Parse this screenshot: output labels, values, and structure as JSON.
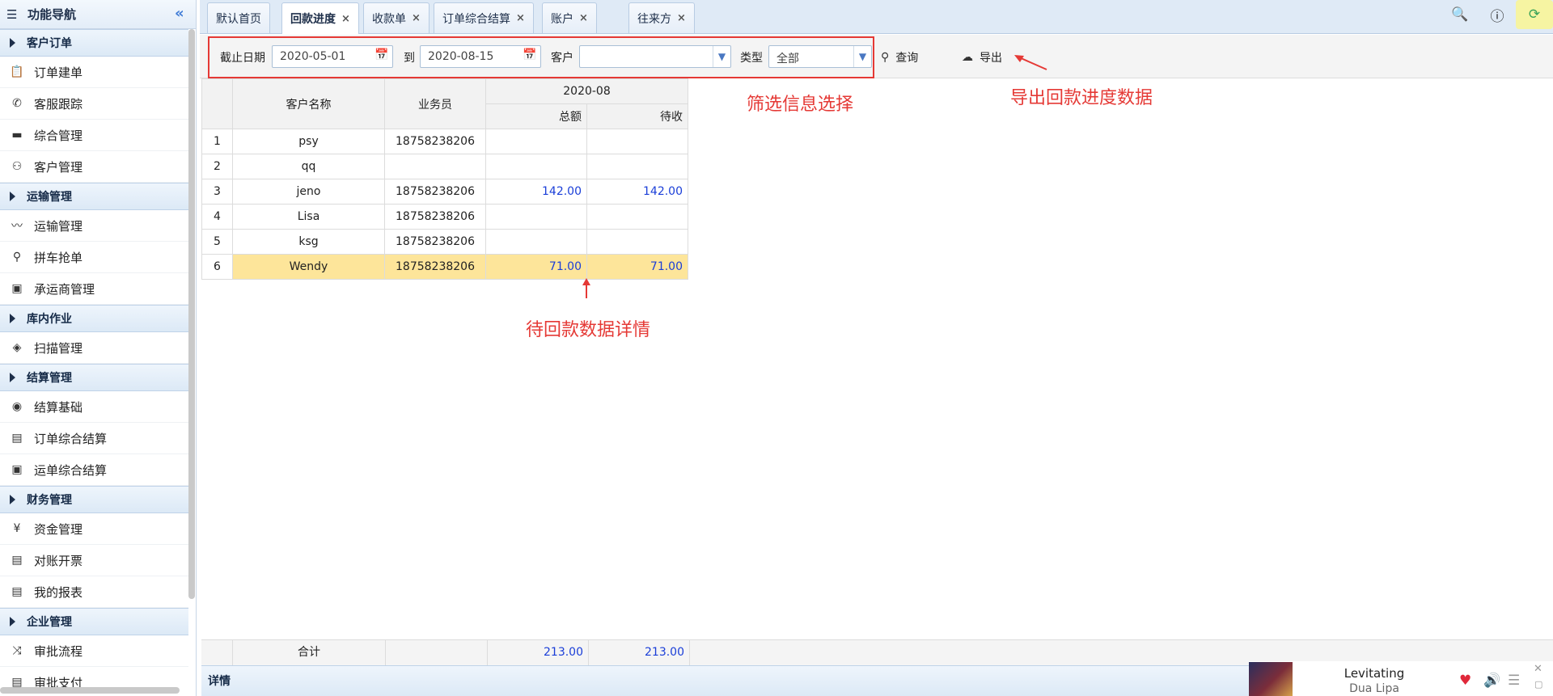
{
  "sidebar": {
    "title": "功能导航",
    "groups": [
      {
        "label": "客户订单",
        "items": [
          {
            "label": "订单建单",
            "icon": "clipboard-icon"
          },
          {
            "label": "客服跟踪",
            "icon": "phone-icon"
          },
          {
            "label": "综合管理",
            "icon": "monitor-icon"
          },
          {
            "label": "客户管理",
            "icon": "users-icon"
          }
        ]
      },
      {
        "label": "运输管理",
        "items": [
          {
            "label": "运输管理",
            "icon": "route-icon"
          },
          {
            "label": "拼车抢单",
            "icon": "map-pin-icon"
          },
          {
            "label": "承运商管理",
            "icon": "bus-icon"
          }
        ]
      },
      {
        "label": "库内作业",
        "items": [
          {
            "label": "扫描管理",
            "icon": "cube-icon"
          }
        ]
      },
      {
        "label": "结算管理",
        "items": [
          {
            "label": "结算基础",
            "icon": "eye-icon"
          },
          {
            "label": "订单综合结算",
            "icon": "document-icon"
          },
          {
            "label": "运单综合结算",
            "icon": "bus-icon"
          }
        ]
      },
      {
        "label": "财务管理",
        "items": [
          {
            "label": "资金管理",
            "icon": "yen-icon"
          },
          {
            "label": "对账开票",
            "icon": "document-icon"
          },
          {
            "label": "我的报表",
            "icon": "document-icon"
          }
        ]
      },
      {
        "label": "企业管理",
        "items": [
          {
            "label": "审批流程",
            "icon": "shuffle-icon"
          },
          {
            "label": "审批支付",
            "icon": "document-icon"
          }
        ]
      }
    ]
  },
  "tabs": [
    {
      "label": "默认首页",
      "closable": false
    },
    {
      "label": "回款进度",
      "closable": true,
      "active": true
    },
    {
      "label": "收款单",
      "closable": true
    },
    {
      "label": "订单综合结算",
      "closable": true
    },
    {
      "label": "账户",
      "closable": true
    },
    {
      "label": "往来方",
      "closable": true
    }
  ],
  "filters": {
    "deadline_label": "截止日期",
    "start_date": "2020-05-01",
    "to_label": "到",
    "end_date": "2020-08-15",
    "customer_label": "客户",
    "customer_value": "",
    "type_label": "类型",
    "type_value": "全部",
    "query_label": "查询",
    "export_label": "导出"
  },
  "grid": {
    "headers": {
      "customer": "客户名称",
      "salesman": "业务员",
      "month": "2020-08",
      "total": "总额",
      "pending": "待收"
    },
    "rows": [
      {
        "no": "1",
        "customer": "psy",
        "salesman": "18758238206",
        "total": "",
        "pending": ""
      },
      {
        "no": "2",
        "customer": "qq",
        "salesman": "",
        "total": "",
        "pending": ""
      },
      {
        "no": "3",
        "customer": "jeno",
        "salesman": "18758238206",
        "total": "142.00",
        "pending": "142.00"
      },
      {
        "no": "4",
        "customer": "Lisa",
        "salesman": "18758238206",
        "total": "",
        "pending": ""
      },
      {
        "no": "5",
        "customer": "ksg",
        "salesman": "18758238206",
        "total": "",
        "pending": ""
      },
      {
        "no": "6",
        "customer": "Wendy",
        "salesman": "18758238206",
        "total": "71.00",
        "pending": "71.00",
        "highlighted": true
      }
    ],
    "footer": {
      "label": "合计",
      "total": "213.00",
      "pending": "213.00"
    }
  },
  "details_label": "详情",
  "annotations": {
    "filter": "筛选信息选择",
    "export": "导出回款进度数据",
    "pending": "待回款数据详情"
  },
  "music": {
    "song": "Levitating",
    "artist": "Dua Lipa"
  },
  "colors": {
    "accent_red": "#e53935",
    "value_blue": "#1a3ed8",
    "highlight": "#fde59a",
    "header_bg": "#dfeaf6"
  }
}
